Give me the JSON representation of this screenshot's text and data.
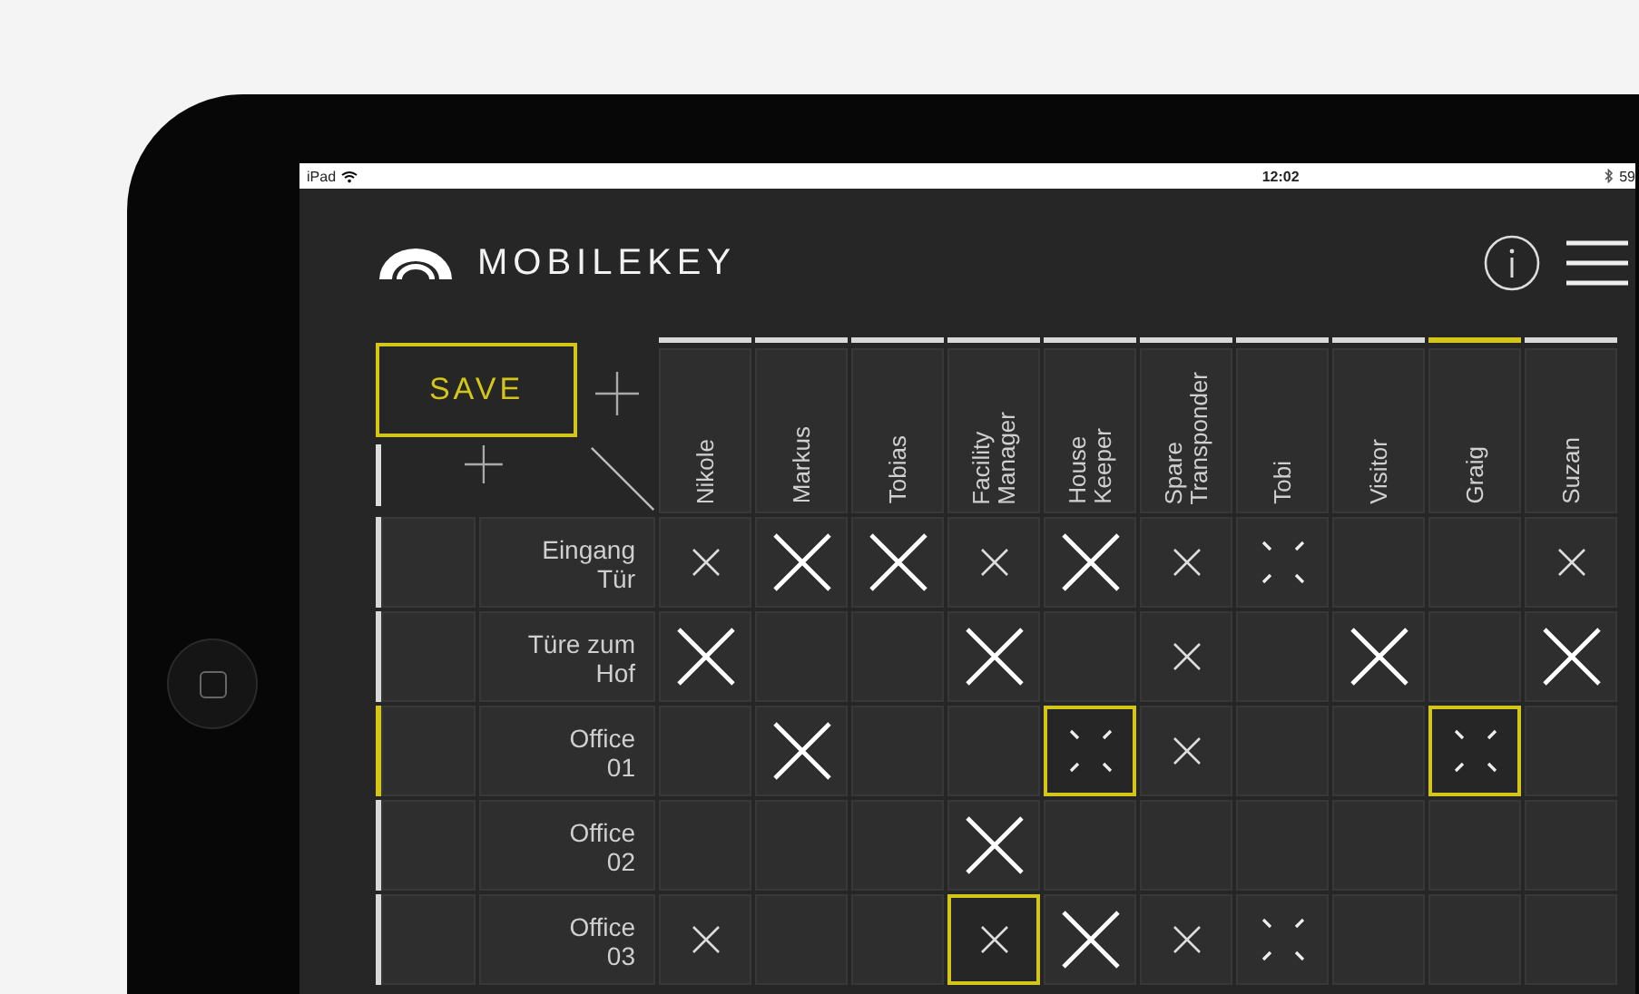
{
  "status_bar": {
    "device": "iPad",
    "time": "12:02",
    "battery": "59"
  },
  "header": {
    "brand": "MOBILEKEY"
  },
  "save_button": {
    "label": "SAVE"
  },
  "columns": [
    {
      "lines": [
        "Nikole"
      ],
      "selected": false
    },
    {
      "lines": [
        "Markus"
      ],
      "selected": false
    },
    {
      "lines": [
        "Tobias"
      ],
      "selected": false
    },
    {
      "lines": [
        "Facility",
        "Manager"
      ],
      "selected": false
    },
    {
      "lines": [
        "House",
        "Keeper"
      ],
      "selected": false
    },
    {
      "lines": [
        "Spare",
        "Transponder"
      ],
      "selected": false
    },
    {
      "lines": [
        "Tobi"
      ],
      "selected": false
    },
    {
      "lines": [
        "Visitor"
      ],
      "selected": false
    },
    {
      "lines": [
        "Graig"
      ],
      "selected": true
    },
    {
      "lines": [
        "Suzan"
      ],
      "selected": false
    }
  ],
  "rows": [
    {
      "lines": [
        "Eingang",
        "Tür"
      ],
      "selected": false,
      "cells": [
        {
          "kind": "small",
          "selected": false
        },
        {
          "kind": "big",
          "selected": false
        },
        {
          "kind": "big",
          "selected": false
        },
        {
          "kind": "small",
          "selected": false
        },
        {
          "kind": "big",
          "selected": false
        },
        {
          "kind": "small",
          "selected": false
        },
        {
          "kind": "pending",
          "selected": false
        },
        {
          "kind": "none",
          "selected": false
        },
        {
          "kind": "none",
          "selected": false
        },
        {
          "kind": "small",
          "selected": false
        }
      ]
    },
    {
      "lines": [
        "Türe zum",
        "Hof"
      ],
      "selected": false,
      "cells": [
        {
          "kind": "big",
          "selected": false
        },
        {
          "kind": "none",
          "selected": false
        },
        {
          "kind": "none",
          "selected": false
        },
        {
          "kind": "big",
          "selected": false
        },
        {
          "kind": "none",
          "selected": false
        },
        {
          "kind": "small",
          "selected": false
        },
        {
          "kind": "none",
          "selected": false
        },
        {
          "kind": "big",
          "selected": false
        },
        {
          "kind": "none",
          "selected": false
        },
        {
          "kind": "big",
          "selected": false
        }
      ]
    },
    {
      "lines": [
        "Office",
        "01"
      ],
      "selected": true,
      "cells": [
        {
          "kind": "none",
          "selected": false
        },
        {
          "kind": "big",
          "selected": false
        },
        {
          "kind": "none",
          "selected": false
        },
        {
          "kind": "none",
          "selected": false
        },
        {
          "kind": "pending",
          "selected": true
        },
        {
          "kind": "small",
          "selected": false
        },
        {
          "kind": "none",
          "selected": false
        },
        {
          "kind": "none",
          "selected": false
        },
        {
          "kind": "pending",
          "selected": true
        },
        {
          "kind": "none",
          "selected": false
        }
      ]
    },
    {
      "lines": [
        "Office",
        "02"
      ],
      "selected": false,
      "cells": [
        {
          "kind": "none",
          "selected": false
        },
        {
          "kind": "none",
          "selected": false
        },
        {
          "kind": "none",
          "selected": false
        },
        {
          "kind": "big",
          "selected": false
        },
        {
          "kind": "none",
          "selected": false
        },
        {
          "kind": "none",
          "selected": false
        },
        {
          "kind": "none",
          "selected": false
        },
        {
          "kind": "none",
          "selected": false
        },
        {
          "kind": "none",
          "selected": false
        },
        {
          "kind": "none",
          "selected": false
        }
      ]
    },
    {
      "lines": [
        "Office",
        "03"
      ],
      "selected": false,
      "cells": [
        {
          "kind": "small",
          "selected": false
        },
        {
          "kind": "none",
          "selected": false
        },
        {
          "kind": "none",
          "selected": false
        },
        {
          "kind": "small",
          "selected": true
        },
        {
          "kind": "big",
          "selected": false
        },
        {
          "kind": "small",
          "selected": false
        },
        {
          "kind": "pending",
          "selected": false
        },
        {
          "kind": "none",
          "selected": false
        },
        {
          "kind": "none",
          "selected": false
        },
        {
          "kind": "none",
          "selected": false
        }
      ]
    }
  ]
}
